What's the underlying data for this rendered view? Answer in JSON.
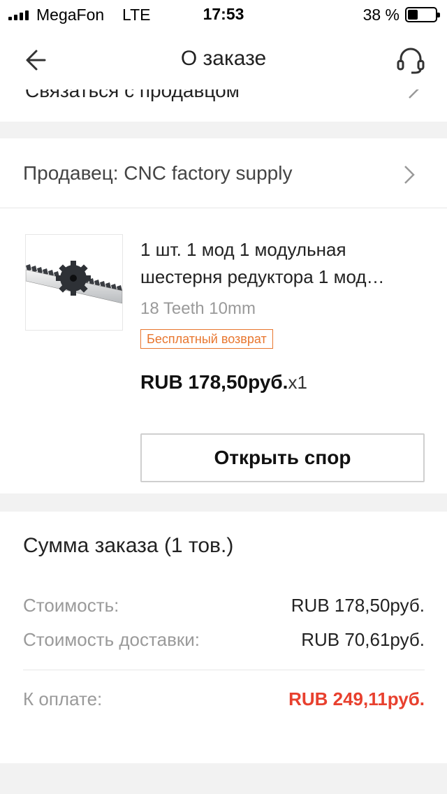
{
  "status_bar": {
    "carrier": "MegaFon",
    "network": "LTE",
    "time": "17:53",
    "battery_percent": "38 %",
    "battery_level": 0.38
  },
  "header": {
    "title": "О заказе",
    "back_icon": "arrow-left-icon",
    "support_icon": "headset-icon"
  },
  "contact_row": {
    "label": "Связаться с продавцом"
  },
  "seller": {
    "label": "Продавец: CNC factory supply"
  },
  "product": {
    "title": "1 шт. 1 мод 1 модульная шестерня редуктора 1 мод…",
    "sku": "18 Teeth 10mm",
    "badge": "Бесплатный возврат",
    "price": "RUB 178,50руб.",
    "quantity": "x1",
    "dispute_button": "Открыть спор"
  },
  "summary": {
    "title": "Сумма заказа (1 тов.)",
    "rows": [
      {
        "label": "Стоимость:",
        "value": "RUB 178,50руб."
      },
      {
        "label": "Стоимость доставки:",
        "value": "RUB 70,61руб."
      }
    ],
    "total": {
      "label": "К оплате:",
      "value": "RUB 249,11руб."
    }
  },
  "colors": {
    "accent_orange": "#e8762e",
    "total_red": "#e8402e",
    "background": "#f2f2f2"
  }
}
